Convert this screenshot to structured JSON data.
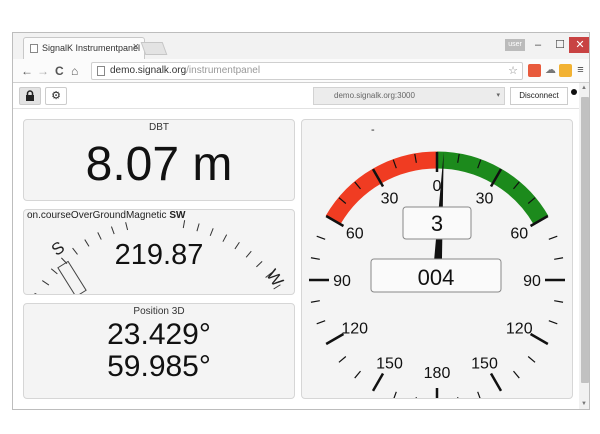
{
  "browser": {
    "tab_title": "SignalK Instrumentpanel",
    "tab_close": "×",
    "url_host": "demo.signalk.org",
    "url_path": "/instrumentpanel",
    "user_badge": "user",
    "win_min": "–",
    "win_max": "☐",
    "win_close": "✕",
    "back": "←",
    "forward": "→",
    "reload": "C",
    "home": "⌂",
    "star": "☆",
    "menu": "≡"
  },
  "toolbar": {
    "lock_icon": "🔒",
    "settings_icon": "⚙",
    "host": "demo.signalk.org:3000",
    "host_arrow": "▾",
    "disconnect_label": "Disconnect"
  },
  "panels": {
    "dbt": {
      "title": "DBT",
      "value": "8.07",
      "unit": "m"
    },
    "cog": {
      "label_prefix": "on.courseOverGroundMagnetic",
      "label_dir": "SW",
      "value": "219.87",
      "letter_s": "S",
      "letter_w": "W"
    },
    "position": {
      "title": "Position 3D",
      "lat": "23.429°",
      "lon": "59.985°"
    },
    "wind": {
      "angle": 3,
      "angle_label": "3",
      "speed_label": "004",
      "top_mark": "-",
      "labels_left": [
        "30",
        "60",
        "90",
        "120",
        "150"
      ],
      "labels_right": [
        "30",
        "60",
        "90",
        "120",
        "150"
      ],
      "label_zero": "0",
      "label_bottom": "180",
      "port_color": "#f03c22",
      "starboard_color": "#1c8a1c"
    }
  }
}
